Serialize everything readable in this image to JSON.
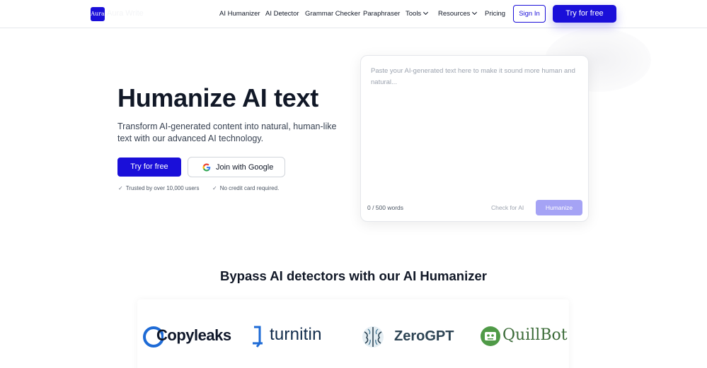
{
  "header": {
    "logo_text": "Aura",
    "brand_name": "Aura Write",
    "nav": [
      {
        "label": "AI Humanizer"
      },
      {
        "label": "AI Detector"
      },
      {
        "label": "Grammar Checker"
      },
      {
        "label": "Paraphraser"
      },
      {
        "label": "Tools"
      },
      {
        "label": "Resources"
      },
      {
        "label": "Pricing"
      }
    ],
    "sign_in": "Sign In",
    "try_free": "Try for free"
  },
  "hero": {
    "title": "Humanize AI text",
    "subtitle": "Transform AI-generated content into natural, human-like text with our advanced AI technology.",
    "primary_button": "Try for free",
    "google_button": "Join with Google",
    "trust": [
      {
        "check": "✓",
        "text": "Trusted by over 10,000 users"
      },
      {
        "check": "✓",
        "text": "No credit card required."
      }
    ]
  },
  "editor": {
    "placeholder": "Paste your AI-generated text here to make it sound more human and natural...",
    "word_count": "0 / 500 words",
    "check_button": "Check for AI",
    "humanize_button": "Humanize"
  },
  "section": {
    "title": "Bypass AI detectors with our AI Humanizer",
    "logos": [
      {
        "name": "Copyleaks",
        "icon": "copyleaks-logo"
      },
      {
        "name": "turnitin",
        "icon": "turnitin-logo"
      },
      {
        "name": "ZeroGPT",
        "icon": "zerogpt-brain-logo"
      },
      {
        "name": "QuillBot",
        "icon": "quillbot-robot-logo"
      }
    ]
  },
  "colors": {
    "brand": "#1a0fd9",
    "humanize_disabled": "#a5a3f5",
    "text": "#111827"
  }
}
